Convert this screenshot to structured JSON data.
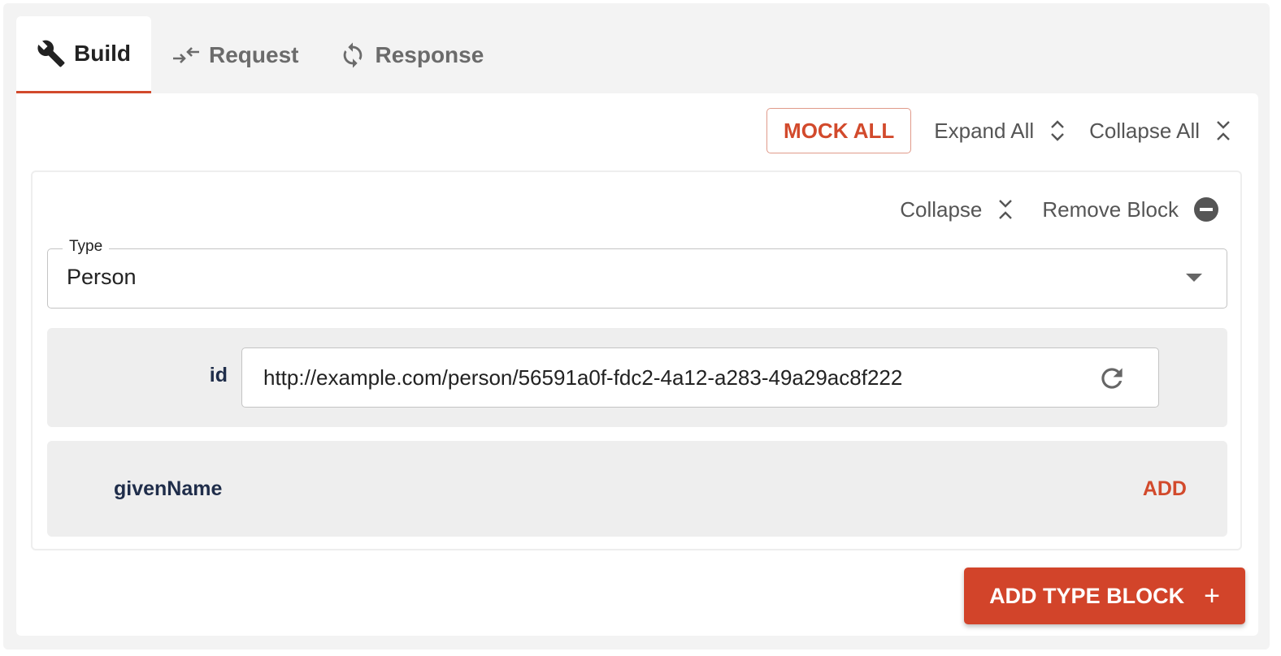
{
  "tabs": [
    {
      "label": "Build",
      "icon": "wrench-icon",
      "active": true
    },
    {
      "label": "Request",
      "icon": "request-arrows-icon",
      "active": false
    },
    {
      "label": "Response",
      "icon": "sync-icon",
      "active": false
    }
  ],
  "toolbar": {
    "mock_all_label": "MOCK ALL",
    "expand_all_label": "Expand All",
    "collapse_all_label": "Collapse All"
  },
  "block": {
    "collapse_label": "Collapse",
    "remove_label": "Remove Block",
    "type_field": {
      "label": "Type",
      "value": "Person"
    },
    "properties": {
      "id": {
        "label": "id",
        "value": "http://example.com/person/56591a0f-fdc2-4a12-a283-49a29ac8f222"
      },
      "given_name": {
        "label": "givenName",
        "action_label": "ADD"
      }
    }
  },
  "add_type_block_label": "ADD TYPE BLOCK",
  "colors": {
    "accent": "#d24a2c",
    "label_navy": "#1f2d4a",
    "row_background": "#eeeeee"
  }
}
